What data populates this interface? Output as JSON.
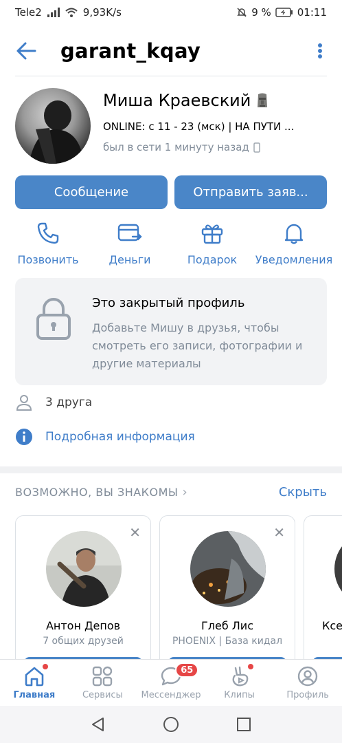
{
  "status_bar": {
    "carrier": "Tele2",
    "speed": "9,93K/s",
    "battery": "9 %",
    "time": "01:11"
  },
  "header": {
    "title": "garant_kqay"
  },
  "profile": {
    "name": "Миша Краевский",
    "status": "ONLINE: с 11 - 23 (мск) | НА ПУТИ ...",
    "last_seen": "был в сети 1 минуту назад"
  },
  "buttons": {
    "message": "Сообщение",
    "friend_request": "Отправить заяв..."
  },
  "actions": [
    {
      "label": "Позвонить",
      "icon": "phone-icon"
    },
    {
      "label": "Деньги",
      "icon": "money-card-icon"
    },
    {
      "label": "Подарок",
      "icon": "gift-icon"
    },
    {
      "label": "Уведомления",
      "icon": "bell-icon"
    }
  ],
  "closed_profile": {
    "title": "Это закрытый профиль",
    "description": "Добавьте Мишу в друзья, чтобы смотреть его записи, фотографии и другие материалы"
  },
  "friends": {
    "count_text": "3 друга"
  },
  "details": {
    "label": "Подробная информация"
  },
  "suggestions": {
    "title": "ВОЗМОЖНО, ВЫ ЗНАКОМЫ",
    "hide_label": "Скрыть",
    "cards": [
      {
        "name": "Антон Депов",
        "subtitle": "7 общих друзей"
      },
      {
        "name": "Глеб Лис",
        "subtitle": "PHOENIX | База кидал"
      },
      {
        "name": "Ксе",
        "subtitle": ""
      }
    ]
  },
  "bottom_nav": {
    "items": [
      {
        "label": "Главная",
        "icon": "home-icon",
        "active": true
      },
      {
        "label": "Сервисы",
        "icon": "services-icon"
      },
      {
        "label": "Мессенджер",
        "icon": "messenger-icon",
        "badge": "65"
      },
      {
        "label": "Клипы",
        "icon": "clips-icon"
      },
      {
        "label": "Профиль",
        "icon": "profile-icon"
      }
    ]
  },
  "colors": {
    "accent": "#4a86c8",
    "link": "#3f7dc9",
    "secondary_text": "#818c99",
    "badge": "#e64646"
  }
}
